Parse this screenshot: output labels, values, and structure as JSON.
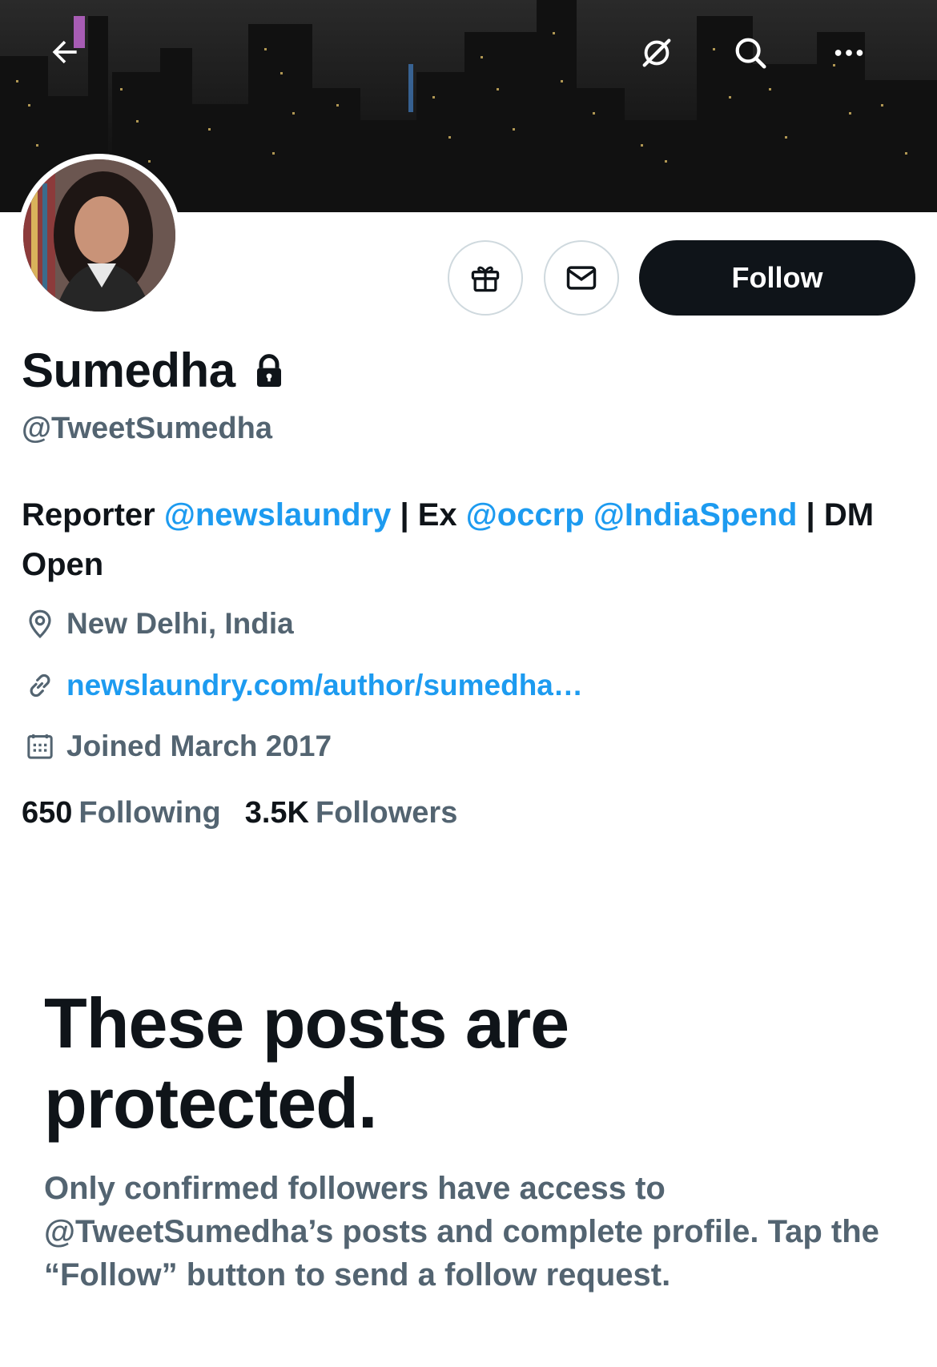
{
  "header": {
    "back_icon": "arrow-left-icon",
    "grok_icon": "grok-icon",
    "search_icon": "search-icon",
    "more_icon": "more-horizontal-icon"
  },
  "profile": {
    "display_name": "Sumedha",
    "handle": "@TweetSumedha",
    "protected_icon": "lock-icon",
    "bio": {
      "part1": "Reporter ",
      "mention1": "@newslaundry",
      "part2": " | Ex ",
      "mention2": "@occrp",
      "space": " ",
      "mention3": "@IndiaSpend",
      "part3": " | DM Open"
    },
    "location": "New Delhi, India",
    "website": "newslaundry.com/author/sumedha…",
    "joined": "Joined March 2017",
    "following_count": "650",
    "following_label": "Following",
    "followers_count": "3.5K",
    "followers_label": "Followers"
  },
  "actions": {
    "gift_icon": "gift-icon",
    "message_icon": "envelope-icon",
    "follow_label": "Follow"
  },
  "protected_notice": {
    "title": "These posts are protected.",
    "body": "Only confirmed followers have access to @TweetSumedha’s posts and complete profile. Tap the “Follow” button to send a follow request."
  },
  "colors": {
    "accent": "#1d9bf0",
    "text_primary": "#0f1419",
    "text_secondary": "#536471",
    "border": "#cfd9de"
  }
}
